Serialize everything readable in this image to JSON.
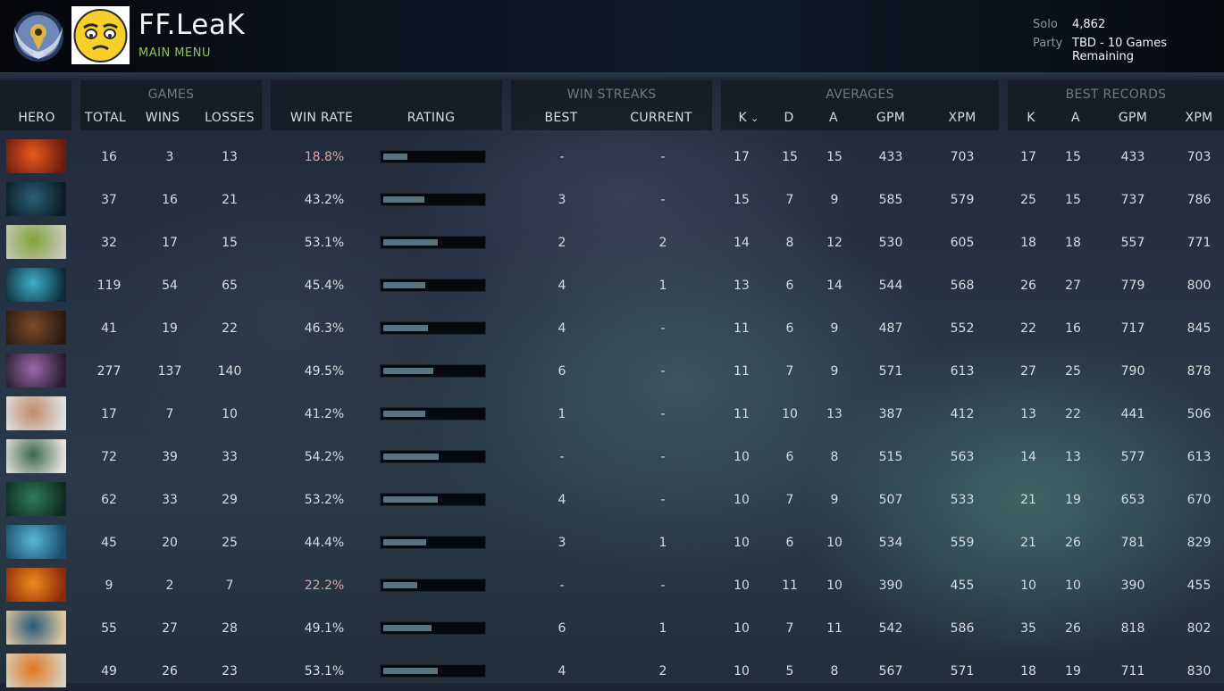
{
  "profile": {
    "name": "FF.LeaK",
    "main_menu": "MAIN MENU",
    "solo_label": "Solo",
    "solo_value": "4,862",
    "party_label": "Party",
    "party_value": "TBD - 10 Games Remaining"
  },
  "header": {
    "hero": "HERO",
    "games": {
      "group": "GAMES",
      "total": "TOTAL",
      "wins": "WINS",
      "losses": "LOSSES"
    },
    "win_rate": "WIN RATE",
    "rating": "RATING",
    "win_streaks": {
      "group": "WIN STREAKS",
      "best": "BEST",
      "current": "CURRENT"
    },
    "averages": {
      "group": "AVERAGES",
      "k": "K",
      "d": "D",
      "a": "A",
      "gpm": "GPM",
      "xpm": "XPM"
    },
    "best_records": {
      "group": "BEST RECORDS",
      "k": "K",
      "a": "A",
      "gpm": "GPM",
      "xpm": "XPM"
    }
  },
  "rows": [
    {
      "portrait": "lina",
      "c1": "#e85a1c",
      "c2": "#6a1a10",
      "total": "16",
      "wins": "3",
      "losses": "13",
      "win_rate": "18.8%",
      "low": true,
      "rating": 0.24,
      "best": "-",
      "current": "-",
      "k": "17",
      "d": "15",
      "a": "15",
      "gpm": "433",
      "xpm": "703",
      "bk": "17",
      "ba": "15",
      "bgpm": "433",
      "bxpm": "703"
    },
    {
      "portrait": "phantom-assassin",
      "c1": "#2b5e74",
      "c2": "#0b1b25",
      "total": "37",
      "wins": "16",
      "losses": "21",
      "win_rate": "43.2%",
      "low": false,
      "rating": 0.41,
      "best": "3",
      "current": "-",
      "k": "15",
      "d": "7",
      "a": "9",
      "gpm": "585",
      "xpm": "579",
      "bk": "25",
      "ba": "15",
      "bgpm": "737",
      "bxpm": "786"
    },
    {
      "portrait": "venomancer",
      "c1": "#7fa33a",
      "c2": "#c8c8b8",
      "total": "32",
      "wins": "17",
      "losses": "15",
      "win_rate": "53.1%",
      "low": false,
      "rating": 0.55,
      "best": "2",
      "current": "2",
      "k": "14",
      "d": "8",
      "a": "12",
      "gpm": "530",
      "xpm": "605",
      "bk": "18",
      "ba": "18",
      "bgpm": "557",
      "bxpm": "771"
    },
    {
      "portrait": "morphling",
      "c1": "#3fb0c8",
      "c2": "#0d2b38",
      "total": "119",
      "wins": "54",
      "losses": "65",
      "win_rate": "45.4%",
      "low": false,
      "rating": 0.42,
      "best": "4",
      "current": "1",
      "k": "13",
      "d": "6",
      "a": "14",
      "gpm": "544",
      "xpm": "568",
      "bk": "26",
      "ba": "27",
      "bgpm": "779",
      "bxpm": "800"
    },
    {
      "portrait": "ursa",
      "c1": "#7a4a2a",
      "c2": "#2a1a12",
      "total": "41",
      "wins": "19",
      "losses": "22",
      "win_rate": "46.3%",
      "low": false,
      "rating": 0.45,
      "best": "4",
      "current": "-",
      "k": "11",
      "d": "6",
      "a": "9",
      "gpm": "487",
      "xpm": "552",
      "bk": "22",
      "ba": "16",
      "bgpm": "717",
      "bxpm": "845"
    },
    {
      "portrait": "templar-assassin",
      "c1": "#9a6aa8",
      "c2": "#2a1a30",
      "total": "277",
      "wins": "137",
      "losses": "140",
      "win_rate": "49.5%",
      "low": false,
      "rating": 0.5,
      "best": "6",
      "current": "-",
      "k": "11",
      "d": "7",
      "a": "9",
      "gpm": "571",
      "xpm": "613",
      "bk": "27",
      "ba": "25",
      "bgpm": "790",
      "bxpm": "878"
    },
    {
      "portrait": "tusk",
      "c1": "#c08a6a",
      "c2": "#e0e0e0",
      "total": "17",
      "wins": "7",
      "losses": "10",
      "win_rate": "41.2%",
      "low": false,
      "rating": 0.42,
      "best": "1",
      "current": "-",
      "k": "11",
      "d": "10",
      "a": "13",
      "gpm": "387",
      "xpm": "412",
      "bk": "13",
      "ba": "22",
      "bgpm": "441",
      "bxpm": "506"
    },
    {
      "portrait": "earthshaker",
      "c1": "#3a6a4a",
      "c2": "#e8e0e0",
      "total": "72",
      "wins": "39",
      "losses": "33",
      "win_rate": "54.2%",
      "low": false,
      "rating": 0.56,
      "best": "-",
      "current": "-",
      "k": "10",
      "d": "6",
      "a": "8",
      "gpm": "515",
      "xpm": "563",
      "bk": "14",
      "ba": "13",
      "bgpm": "577",
      "bxpm": "613"
    },
    {
      "portrait": "viper",
      "c1": "#2e7a5a",
      "c2": "#0e2a20",
      "total": "62",
      "wins": "33",
      "losses": "29",
      "win_rate": "53.2%",
      "low": false,
      "rating": 0.55,
      "best": "4",
      "current": "-",
      "k": "10",
      "d": "7",
      "a": "9",
      "gpm": "507",
      "xpm": "533",
      "bk": "21",
      "ba": "19",
      "bgpm": "653",
      "bxpm": "670"
    },
    {
      "portrait": "puck",
      "c1": "#58b8d8",
      "c2": "#1a4a68",
      "total": "45",
      "wins": "20",
      "losses": "25",
      "win_rate": "44.4%",
      "low": false,
      "rating": 0.43,
      "best": "3",
      "current": "1",
      "k": "10",
      "d": "6",
      "a": "10",
      "gpm": "534",
      "xpm": "559",
      "bk": "21",
      "ba": "26",
      "bgpm": "781",
      "bxpm": "829"
    },
    {
      "portrait": "phoenix",
      "c1": "#f08a20",
      "c2": "#8a2a08",
      "total": "9",
      "wins": "2",
      "losses": "7",
      "win_rate": "22.2%",
      "low": true,
      "rating": 0.34,
      "best": "-",
      "current": "-",
      "k": "10",
      "d": "11",
      "a": "10",
      "gpm": "390",
      "xpm": "455",
      "bk": "10",
      "ba": "10",
      "bgpm": "390",
      "bxpm": "455"
    },
    {
      "portrait": "slark",
      "c1": "#2a5878",
      "c2": "#e0c8a0",
      "total": "55",
      "wins": "27",
      "losses": "28",
      "win_rate": "49.1%",
      "low": false,
      "rating": 0.49,
      "best": "6",
      "current": "1",
      "k": "10",
      "d": "7",
      "a": "11",
      "gpm": "542",
      "xpm": "586",
      "bk": "35",
      "ba": "26",
      "bgpm": "818",
      "bxpm": "802"
    },
    {
      "portrait": "clinkz",
      "c1": "#e07820",
      "c2": "#d8d0c0",
      "total": "49",
      "wins": "26",
      "losses": "23",
      "win_rate": "53.1%",
      "low": false,
      "rating": 0.55,
      "best": "4",
      "current": "2",
      "k": "10",
      "d": "5",
      "a": "8",
      "gpm": "567",
      "xpm": "571",
      "bk": "18",
      "ba": "19",
      "bgpm": "711",
      "bxpm": "830"
    }
  ]
}
